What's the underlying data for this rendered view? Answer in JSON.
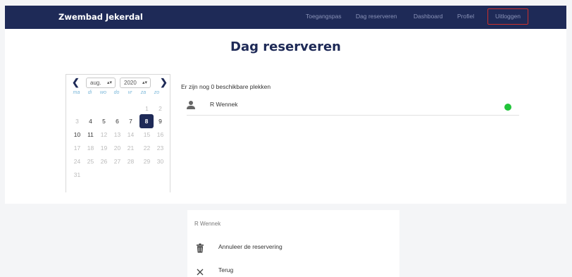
{
  "navbar": {
    "brand": "Zwembad Jekerdal",
    "links": [
      "Toegangspas",
      "Dag reserveren",
      "Dashboard",
      "Profiel"
    ],
    "logout": "Uitloggen"
  },
  "page": {
    "title": "Dag reserveren"
  },
  "calendar": {
    "prev_icon": "chevron-left-icon",
    "next_icon": "chevron-right-icon",
    "month": "aug.",
    "year": "2020",
    "weekdays": [
      "ma",
      "di",
      "wo",
      "do",
      "vr",
      "za",
      "zo"
    ],
    "days_inactive_top": [
      "1",
      "2"
    ],
    "selected_day": "8"
  },
  "availability": {
    "text": "Er zijn nog 0 beschikbare plekken"
  },
  "reservation": {
    "name": "R Wennek",
    "status_color": "#21c43a"
  },
  "sheet": {
    "title": "R Wennek",
    "cancel_label": "Annuleer de reservering",
    "back_label": "Terug"
  }
}
